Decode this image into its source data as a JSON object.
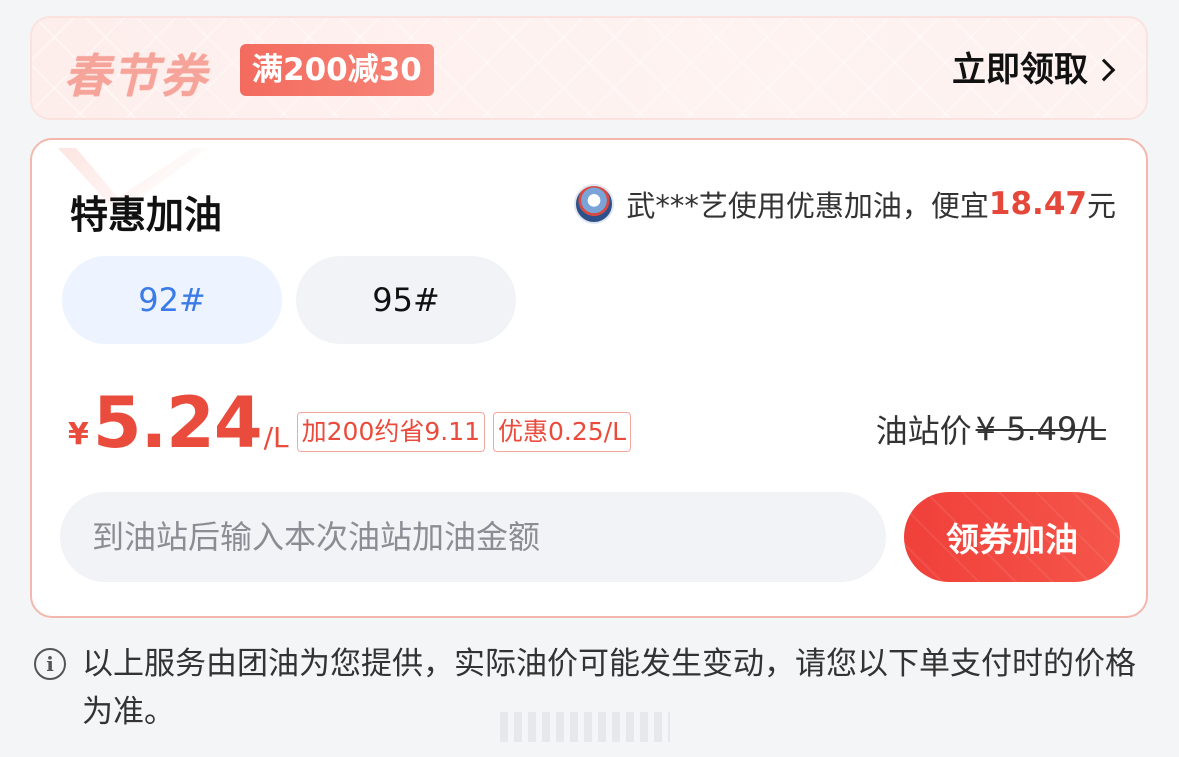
{
  "banner": {
    "title": "春节券",
    "coupon_text": "满200减30",
    "claim_label": "立即领取",
    "claim_icon": "chevron-right-icon"
  },
  "card": {
    "title": "特惠加油",
    "savings": {
      "prefix": "武***艺使用优惠加油，便宜",
      "amount": "18.47",
      "suffix": "元"
    },
    "grades": [
      {
        "label": "92#",
        "selected": true
      },
      {
        "label": "95#",
        "selected": false
      }
    ],
    "price": {
      "currency": "¥",
      "value": "5.24",
      "unit": "/L",
      "tags": [
        "加200约省9.11",
        "优惠0.25/L"
      ]
    },
    "station_price": {
      "label": "油站价",
      "value": "¥ 5.49/L"
    },
    "amount_input": {
      "placeholder": "到油站后输入本次油站加油金额",
      "value": ""
    },
    "action_label": "领券加油"
  },
  "footer": {
    "note": "以上服务由团油为您提供，实际油价可能发生变动，请您以下单支付时的价格为准。",
    "icon": "info-icon"
  },
  "colors": {
    "accent_red": "#e94b3c",
    "selected_blue": "#3a7be8",
    "pill_bg": "#f2f3f6"
  }
}
